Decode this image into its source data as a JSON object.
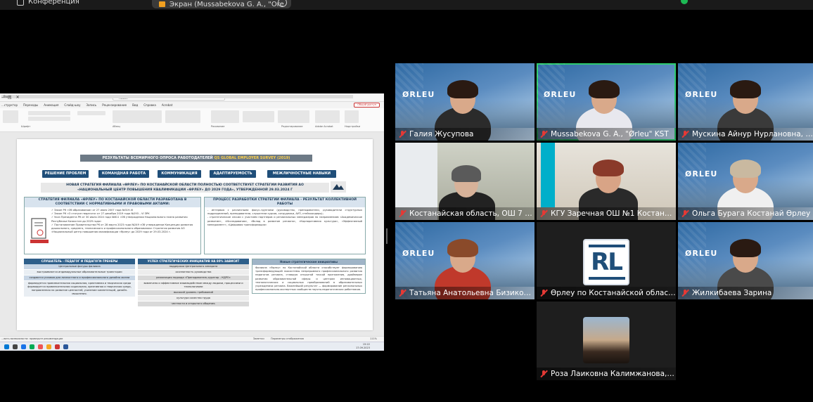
{
  "topbar": {
    "conference_label": "Конференция",
    "share_label": "Экран (Mussabekova G. A., \"Ore"
  },
  "ppt": {
    "window_title": "...развитие - PowerPoint",
    "search_placeholder": "Поиск",
    "sign_in": "Вход",
    "menu": [
      "...структор",
      "Переходы",
      "Анимация",
      "Слайд-шоу",
      "Запись",
      "Рецензирование",
      "Вид",
      "Справка",
      "Acrobat"
    ],
    "shared_button": "Общий доступ",
    "groups": [
      "Шрифт",
      "Абзац",
      "Рисование",
      "Редактирование",
      "Adobe Acrobat",
      "Надстройки"
    ],
    "ribbon_right": [
      "Найти",
      "Заменить",
      "Выделить",
      "Создать и поделиться Adobe PDF",
      "Надстройки"
    ],
    "status_text": "...вать возможности: проверьте рекомендации",
    "status_notes": "Заметки",
    "status_display": "Параметры отображения",
    "zoom": "111%",
    "clock_time": "15:22",
    "clock_date": "17.09.2023"
  },
  "slide": {
    "header_prefix": "РЕЗУЛЬТАТЫ ВСЕМИРНОГО ОПРОСА РАБОТОДАТЕЛЕЙ ",
    "header_highlight": "QS GLOBAL EMPLOYER SURVEY (2019)",
    "skills": [
      "РЕШЕНИЕ ПРОБЛЕМ",
      "КОМАНДНАЯ РАБОТА",
      "КОММУНИКАЦИЯ",
      "АДАПТИРУЕМОСТЬ",
      "МЕЖЛИЧНОСТНЫЕ НАВЫКИ"
    ],
    "strategy_line1": "НОВАЯ СТРАТЕГИЯ ФИЛИАЛА «ӨРЛЕУ» ПО КОСТАНАЙСКОЙ ОБЛАСТИ ПОЛНОСТЬЮ СООТВЕТСТВУЕТ СТРАТЕГИИ РАЗВИТИЯ АО",
    "strategy_line2": "«НАЦИОНАЛЬНЫЙ ЦЕНТР ПОВЫШЕНИЯ КВАЛИФИКАЦИИ «ӨРЛЕУ» ДО 2029 ГОДА», УТВЕРЖДЕННОЙ 29.03.2024 Г",
    "left_panel_title": "СТРАТЕГИЯ ФИЛИАЛА «ӨРЛЕУ» ПО КОСТАНАЙСКОЙ ОБЛАСТИ РАЗРАБОТАНА В СООТВЕТСТВИИ С НОРМАТИВНЫМИ И ПРАВОВЫМИ АКТАМИ:",
    "left_panel_items": [
      "✓ Закон РК «Об образовании» от 27 июля 2007 года №319-III",
      "✓ Закон РК «О статусе педагога» от 27 декабря 2019 года №293 – VI ЗРК",
      "✓ Указ Президента РК от 30 июля 2024 года №611 «Об утверждении Национального плана развития Республики Казахстан до 2029 года»",
      "✓ Постановление Правительства РК от 28 марта 2023 года №249 «Об утверждении Концепции развития дошкольного, среднего, технического и профессионального образования» Стратегия развития АО «Национальный центр повышения квалификации «Өрлеу» до 2029 года от 29.03.2024 г."
    ],
    "right_panel_title": "ПРОЦЕСС РАЗРАБОТКИ СТРАТЕГИИ ФИЛИАЛА - РЕЗУЛЬТАТ КОЛЛЕКТИВНОЙ РАБОТЫ",
    "right_panel_items": [
      "- интервью с различными фокус-группами (руководство, преподаватели, руководители структурных подразделений, преподаватели, слушатели курсов, сотрудники, АУП, стейкхолдеры);",
      "- стратегические сессии с участием партнеров и региональных менеджеров по направлениям «Академическое развитие», «Исследования», «Вклад в развитие региона», «Корпоративная культура», «Эффективный менеджмент», «Цифровая трансформация»"
    ],
    "col1_title": "СЛУШАТЕЛЬ - ПЕДАГОГ И ПЕДАГОГИ-ТРЕНЕРЫ",
    "col1_rows": [
      "Центральные фигуры филиала",
      "выстраиваются индивидуальные образовательные траектории",
      "создаются условия для личностного и профессионального дизайна жизни",
      "формируется привлекательная социальная, креативная и творческая среда формируется привлекательная социальная, креативная и творческая среда, направленная на развитие ценностей, усиление компетенций, дизайн-мышления."
    ],
    "col2_title": "УСПЕХ СТРАТЕГИЧЕСКИХ ИНИЦИАТИВ НА 80% ЗАВИСИТ",
    "col2_rows": [
      "поддержка Центрального аппарата",
      "осознанность руководства",
      "реализация подхода «Преподаватель-куратор – КДРО»",
      "вовлечено и эффективное взаимодействие между людьми, процессами и технологиями",
      "высокий уровень требований",
      "культура качества труда",
      "честности и открытого общения."
    ],
    "col3_title": "Новые стратегические инициативы",
    "col3_body": "Филиала «Өрлеу» по Костанайской области способствует формированию трансформирующей экосистемы непрерывного профессионального развития педагогов региона, ставшую открытой точкой притяжения, драйвером развития образовательной сферы и центром инновационных, технологических и социальных преобразований в образовательных учреждениях региона. Важнейший результат — формирование региональных профессионально-экспертных сообществ научно-педагогических работников."
  },
  "participants": [
    {
      "name": "Галия Жусупова",
      "muted": true
    },
    {
      "name": "Mussabekova G. A., \"Ørleu\" KST",
      "muted": true
    },
    {
      "name": "Мускина Айнур Нурлановна, Коста...",
      "muted": true
    },
    {
      "name": "Костанайская область, ОШ 7 г.Коста...",
      "muted": true
    },
    {
      "name": "КГУ Заречная ОШ №1 Костанайско...",
      "muted": true
    },
    {
      "name": "Ольга Бурага Костанай Өрлеу",
      "muted": true
    },
    {
      "name": "Татьяна Анатольевна Бизикова, Өрл...",
      "muted": true
    },
    {
      "name": "Өрлеу по Костанайской области",
      "muted": true
    },
    {
      "name": "Жилкибаева Зарина",
      "muted": true
    },
    {
      "name": "Роза Лаиковна Калимжанова, зав.ка...",
      "muted": true
    }
  ],
  "branding": {
    "orleu_logo": "ØRLEU",
    "rl_logo": "RL",
    "accent_active": "#2ecc71",
    "mute_color": "#e53935",
    "slide_header_color": "#1f4e79"
  }
}
